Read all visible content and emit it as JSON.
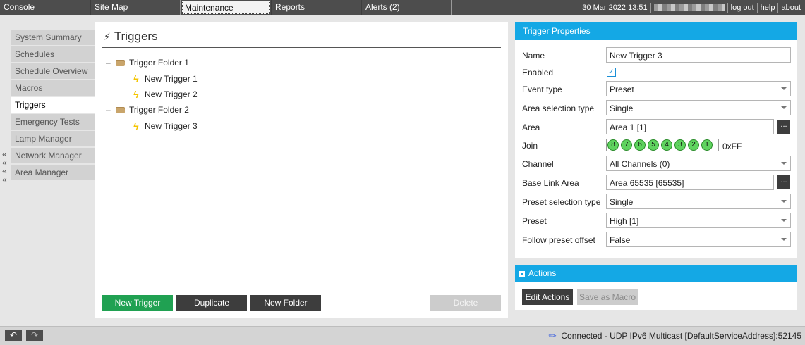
{
  "topbar": {
    "tabs": [
      {
        "label": "Console"
      },
      {
        "label": "Site Map"
      },
      {
        "label": "Maintenance",
        "active": true
      },
      {
        "label": "Reports"
      },
      {
        "label": "Alerts (2)"
      }
    ],
    "datetime": "30 Mar 2022 13:51",
    "logout": "log out",
    "help": "help",
    "about": "about"
  },
  "leftnav": {
    "items": [
      {
        "label": "System Summary"
      },
      {
        "label": "Schedules"
      },
      {
        "label": "Schedule Overview"
      },
      {
        "label": "Macros"
      },
      {
        "label": "Triggers",
        "active": true
      },
      {
        "label": "Emergency Tests"
      },
      {
        "label": "Lamp Manager"
      },
      {
        "label": "Network Manager"
      },
      {
        "label": "Area Manager"
      }
    ],
    "collapse_glyph": "«"
  },
  "center": {
    "title": "Triggers",
    "tree": {
      "folders": [
        {
          "label": "Trigger Folder 1",
          "expander": "–",
          "triggers": [
            "New Trigger 1",
            "New Trigger 2"
          ]
        },
        {
          "label": "Trigger Folder 2",
          "expander": "–",
          "triggers": [
            "New Trigger 3"
          ]
        }
      ]
    },
    "buttons": {
      "new_trigger": "New Trigger",
      "duplicate": "Duplicate",
      "new_folder": "New Folder",
      "delete": "Delete"
    }
  },
  "properties": {
    "header": "Trigger Properties",
    "name_label": "Name",
    "name_value": "New Trigger 3",
    "enabled_label": "Enabled",
    "enabled_checked": true,
    "event_type_label": "Event type",
    "event_type_value": "Preset",
    "area_selection_type_label": "Area selection type",
    "area_selection_type_value": "Single",
    "area_label": "Area",
    "area_value": "Area 1 [1]",
    "join_label": "Join",
    "join_bits": [
      "8",
      "7",
      "6",
      "5",
      "4",
      "3",
      "2",
      "1"
    ],
    "join_hex": "0xFF",
    "channel_label": "Channel",
    "channel_value": "All Channels (0)",
    "base_link_area_label": "Base Link Area",
    "base_link_area_value": "Area 65535 [65535]",
    "preset_selection_type_label": "Preset selection type",
    "preset_selection_type_value": "Single",
    "preset_label": "Preset",
    "preset_value": "High [1]",
    "follow_preset_offset_label": "Follow preset offset",
    "follow_preset_offset_value": "False",
    "ellipsis": "..."
  },
  "actions": {
    "header": "Actions",
    "edit_actions": "Edit Actions",
    "save_as_macro": "Save as Macro"
  },
  "statusbar": {
    "connection": "Connected - UDP IPv6 Multicast [DefaultServiceAddress]:52145"
  },
  "colors": {
    "accent": "#14a8e5",
    "primary_button": "#20a152",
    "dark_button": "#3d3d3d",
    "topbar": "#4d4d4d"
  }
}
